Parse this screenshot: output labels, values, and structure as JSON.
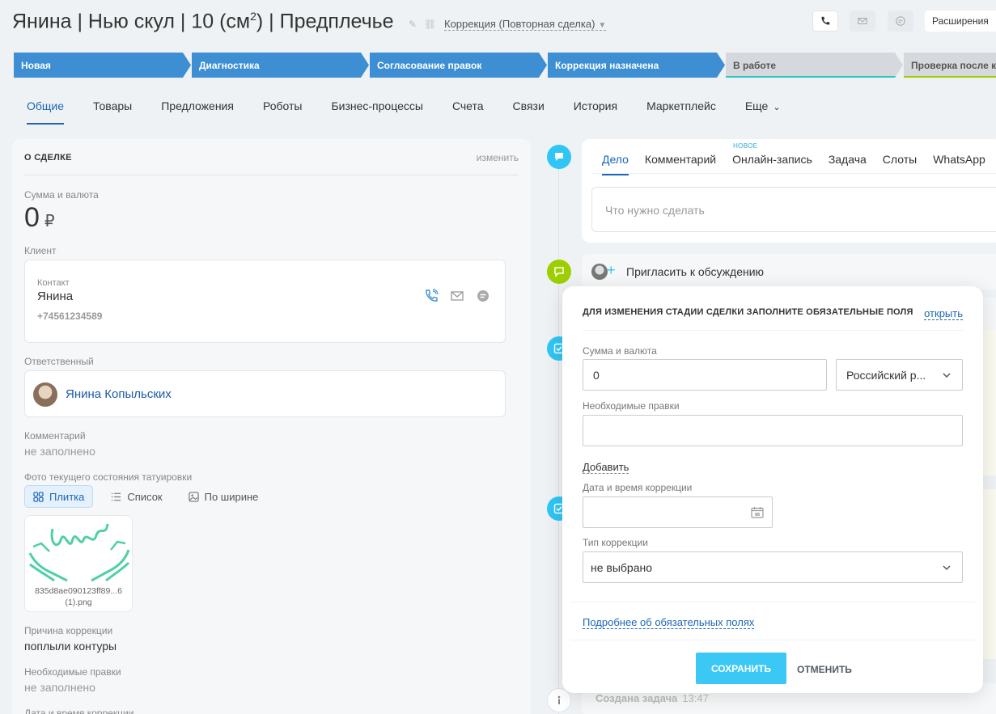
{
  "header": {
    "title_main": "Янина | Нью скул | 10 (см",
    "title_sup": "2",
    "title_tail": ") | Предплечье",
    "category": "Коррекция (Повторная сделка)",
    "extensions_label": "Расширения"
  },
  "stages": [
    {
      "label": "Новая",
      "state": "active"
    },
    {
      "label": "Диагностика",
      "state": "active"
    },
    {
      "label": "Согласование правок",
      "state": "active"
    },
    {
      "label": "Коррекция назначена",
      "state": "active"
    },
    {
      "label": "В работе",
      "state": "inactive"
    },
    {
      "label": "Проверка после коррекции",
      "state": "inactive"
    }
  ],
  "tabs": [
    {
      "label": "Общие",
      "active": true
    },
    {
      "label": "Товары"
    },
    {
      "label": "Предложения"
    },
    {
      "label": "Роботы"
    },
    {
      "label": "Бизнес-процессы"
    },
    {
      "label": "Счета"
    },
    {
      "label": "Связи"
    },
    {
      "label": "История"
    },
    {
      "label": "Маркетплейс"
    },
    {
      "label": "Еще"
    }
  ],
  "deal": {
    "section_title": "О СДЕЛКЕ",
    "edit_label": "изменить",
    "sum_label": "Сумма и валюта",
    "sum_value": "0",
    "currency_symbol": "₽",
    "client_label": "Клиент",
    "contact_type": "Контакт",
    "contact_name": "Янина",
    "contact_phone": "+74561234589",
    "responsible_label": "Ответственный",
    "responsible_name": "Янина Копыльских",
    "comment_label": "Комментарий",
    "comment_value": "не заполнено",
    "photo_label": "Фото текущего состояния татуировки",
    "view_tile": "Плитка",
    "view_list": "Список",
    "view_wide": "По ширине",
    "file_name": "835d8ae090123ff89...6 (1).png",
    "reason_label": "Причина коррекции",
    "reason_value": "поплыли контуры",
    "edits_label": "Необходимые правки",
    "edits_value": "не заполнено",
    "datetime_label": "Дата и время коррекции"
  },
  "activity": {
    "tabs": [
      "Дело",
      "Комментарий",
      "Онлайн-запись",
      "Задача",
      "Слоты",
      "WhatsApp"
    ],
    "new_badge": "НОВОЕ",
    "placeholder": "Что нужно сделать",
    "invite": "Пригласить к обсуждению",
    "bottom_event": "Создана задача",
    "bottom_time": "13:47"
  },
  "popup": {
    "heading": "ДЛЯ ИЗМЕНЕНИЯ СТАДИИ СДЕЛКИ ЗАПОЛНИТЕ ОБЯЗАТЕЛЬНЫЕ ПОЛЯ",
    "open_link": "открыть",
    "sum_label": "Сумма и валюта",
    "sum_value": "0",
    "currency_value": "Российский р...",
    "edits_label": "Необходимые правки",
    "edits_value": "",
    "add_label": "Добавить",
    "datetime_label": "Дата и время коррекции",
    "datetime_value": "",
    "type_label": "Тип коррекции",
    "type_value": "не выбрано",
    "more_link": "Подробнее об обязательных полях",
    "save_label": "СОХРАНИТЬ",
    "cancel_label": "ОТМЕНИТЬ"
  },
  "colors": {
    "stage_active": "#3d8ed3",
    "link": "#1c66b6",
    "save_button": "#3bc8f5",
    "timeline_blue": "#2fc6f6",
    "timeline_green": "#9dcf00"
  }
}
